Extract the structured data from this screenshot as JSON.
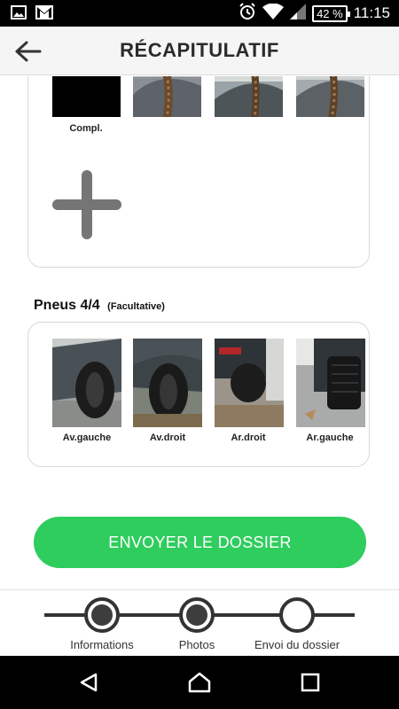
{
  "status_bar": {
    "time": "11:15",
    "battery": "42 %",
    "icons": [
      "image-icon",
      "gmail-icon",
      "alarm-icon",
      "wifi-icon",
      "signal-icon",
      "battery-icon"
    ]
  },
  "app_bar": {
    "title": "RÉCAPITULATIF",
    "back_icon": "arrow-left-icon"
  },
  "documents_card": {
    "photos": [
      {
        "label": "Compl."
      },
      {
        "label": ""
      },
      {
        "label": ""
      },
      {
        "label": ""
      }
    ],
    "add_icon": "plus-icon"
  },
  "tyres_section": {
    "title": "Pneus 4/4",
    "subtitle": "(Facultative)",
    "photos": [
      {
        "label": "Av.gauche"
      },
      {
        "label": "Av.droit"
      },
      {
        "label": "Ar.droit"
      },
      {
        "label": "Ar.gauche"
      }
    ]
  },
  "send_button": {
    "label": "ENVOYER LE DOSSIER",
    "color": "#2fcc5e"
  },
  "stepper": {
    "steps": [
      {
        "label": "Informations",
        "completed": true
      },
      {
        "label": "Photos",
        "completed": true
      },
      {
        "label": "Envoi du dossier",
        "completed": false
      }
    ]
  },
  "nav_bar": {
    "icons": [
      "back-triangle-icon",
      "home-icon",
      "recents-square-icon"
    ]
  }
}
